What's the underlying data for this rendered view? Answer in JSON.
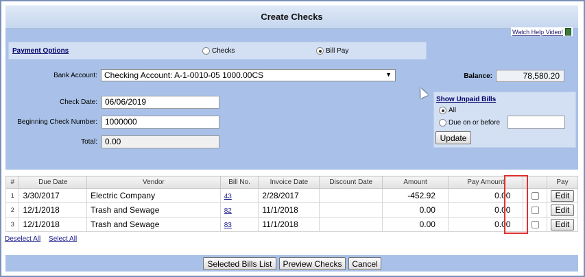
{
  "title": "Create Checks",
  "help_link": "Watch Help Video!",
  "payment_options": {
    "label": "Payment Options",
    "options": [
      {
        "label": "Checks",
        "selected": false
      },
      {
        "label": "Bill Pay",
        "selected": true
      }
    ]
  },
  "bank_account": {
    "label": "Bank Account:",
    "value": "Checking Account: A-1-0010-05 1000.00CS"
  },
  "balance": {
    "label": "Balance:",
    "value": "78,580.20"
  },
  "check_date": {
    "label": "Check Date:",
    "value": "06/06/2019"
  },
  "beginning_check_number": {
    "label": "Beginning Check Number:",
    "value": "1000000"
  },
  "total": {
    "label": "Total:",
    "value": "0.00"
  },
  "unpaid_bills": {
    "label": "Show Unpaid Bills",
    "options": [
      {
        "label": "All",
        "selected": true
      },
      {
        "label": "Due on or before",
        "selected": false
      }
    ],
    "date_value": "",
    "update_label": "Update"
  },
  "table": {
    "headers": [
      "#",
      "Due Date",
      "Vendor",
      "Bill No.",
      "Invoice Date",
      "Discount Date",
      "Amount",
      "Pay Amount",
      "",
      "Pay"
    ],
    "rows": [
      {
        "idx": "1",
        "due_date": "3/30/2017",
        "vendor": "Electric Company",
        "bill_no": "43",
        "invoice_date": "2/28/2017",
        "discount_date": "",
        "amount": "-452.92",
        "pay_amount": "0.00",
        "checked": false,
        "pay_label": "Edit"
      },
      {
        "idx": "2",
        "due_date": "12/1/2018",
        "vendor": "Trash and Sewage",
        "bill_no": "82",
        "invoice_date": "11/1/2018",
        "discount_date": "",
        "amount": "0.00",
        "pay_amount": "0.00",
        "checked": false,
        "pay_label": "Edit"
      },
      {
        "idx": "3",
        "due_date": "12/1/2018",
        "vendor": "Trash and Sewage",
        "bill_no": "83",
        "invoice_date": "11/1/2018",
        "discount_date": "",
        "amount": "0.00",
        "pay_amount": "0.00",
        "checked": false,
        "pay_label": "Edit"
      }
    ]
  },
  "links": {
    "deselect_all": "Deselect All",
    "select_all": "Select All"
  },
  "footer": {
    "selected_bills": "Selected Bills List",
    "preview_checks": "Preview Checks",
    "cancel": "Cancel"
  },
  "colors": {
    "panel": "#a9c1e8",
    "highlight": "#e03030"
  }
}
